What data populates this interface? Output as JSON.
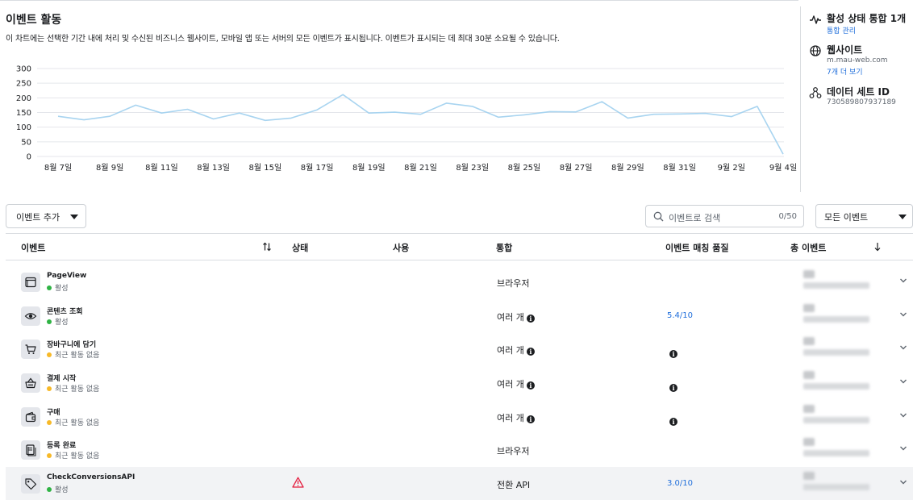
{
  "header": {
    "title": "이벤트 활동",
    "subtitle": "이 차트에는 선택한 기간 내에 처리 및 수신된 비즈니스 웹사이트, 모바일 앱 또는 서버의 모든 이벤트가 표시됩니다. 이벤트가 표시되는 데 최대 30분 소요될 수 있습니다."
  },
  "chart_data": {
    "type": "line",
    "y_ticks": [
      "300",
      "250",
      "200",
      "150",
      "100",
      "50",
      "0"
    ],
    "ylim": [
      0,
      300
    ],
    "x_tick_labels": [
      "8월 7일",
      "8월 9일",
      "8월 11일",
      "8월 13일",
      "8월 15일",
      "8월 17일",
      "8월 19일",
      "8월 21일",
      "8월 23일",
      "8월 25일",
      "8월 27일",
      "8월 29일",
      "8월 31일",
      "9월 2일",
      "9월 4일"
    ],
    "x": [
      "8월 7일",
      "8월 8일",
      "8월 9일",
      "8월 10일",
      "8월 11일",
      "8월 12일",
      "8월 13일",
      "8월 14일",
      "8월 15일",
      "8월 16일",
      "8월 17일",
      "8월 18일",
      "8월 19일",
      "8월 20일",
      "8월 21일",
      "8월 22일",
      "8월 23일",
      "8월 24일",
      "8월 25일",
      "8월 26일",
      "8월 27일",
      "8월 28일",
      "8월 29일",
      "8월 30일",
      "8월 31일",
      "9월 1일",
      "9월 2일",
      "9월 3일",
      "9월 4일"
    ],
    "values": [
      137,
      125,
      137,
      175,
      148,
      161,
      128,
      148,
      123,
      131,
      159,
      211,
      148,
      151,
      144,
      182,
      171,
      134,
      142,
      153,
      152,
      187,
      131,
      144,
      145,
      147,
      136,
      171,
      8
    ],
    "grid": true,
    "line_color": "#a8d4f0",
    "grid_color": "#e4e6eb"
  },
  "side_panel": {
    "integration_title": "활성 상태 통합 1개",
    "integration_link": "통합 관리",
    "website_title": "웹사이트",
    "website_domain": "m.mau-web.com",
    "website_more": "7개 더 보기",
    "dataset_title": "데이터 세트 ID",
    "dataset_id": "730589807937189"
  },
  "toolbar": {
    "add_event": "이벤트 추가",
    "search_placeholder": "이벤트로 검색",
    "search_count": "0/50",
    "filter": "모든 이벤트"
  },
  "table": {
    "columns": {
      "event": "이벤트",
      "status": "상태",
      "usage": "사용",
      "integration": "통합",
      "match_quality": "이벤트 매칭 품질",
      "total_events": "총 이벤트"
    },
    "rows": [
      {
        "name": "PageView",
        "status": "활성",
        "status_color": "#2fb344",
        "integration": "브라우저",
        "integration_info": false,
        "quality": "",
        "quality_info": false,
        "icon": "browser-window-icon",
        "warning": false
      },
      {
        "name": "콘텐츠 조회",
        "status": "활성",
        "status_color": "#2fb344",
        "integration": "여러 개",
        "integration_info": true,
        "quality": "5.4/10",
        "quality_info": false,
        "icon": "eye-icon",
        "warning": false
      },
      {
        "name": "장바구니에 담기",
        "status": "최근 활동 없음",
        "status_color": "#f7b928",
        "integration": "여러 개",
        "integration_info": true,
        "quality": "",
        "quality_info": true,
        "icon": "cart-icon",
        "warning": false
      },
      {
        "name": "결제 시작",
        "status": "최근 활동 없음",
        "status_color": "#f7b928",
        "integration": "여러 개",
        "integration_info": true,
        "quality": "",
        "quality_info": true,
        "icon": "basket-icon",
        "warning": false
      },
      {
        "name": "구매",
        "status": "최근 활동 없음",
        "status_color": "#f7b928",
        "integration": "여러 개",
        "integration_info": true,
        "quality": "",
        "quality_info": true,
        "icon": "wallet-icon",
        "warning": false
      },
      {
        "name": "등록 완료",
        "status": "최근 활동 없음",
        "status_color": "#f7b928",
        "integration": "브라우저",
        "integration_info": false,
        "quality": "",
        "quality_info": false,
        "icon": "document-icon",
        "warning": false
      },
      {
        "name": "CheckConversionsAPI",
        "status": "활성",
        "status_color": "#2fb344",
        "integration": "전환 API",
        "integration_info": false,
        "quality": "3.0/10",
        "quality_info": false,
        "icon": "tag-icon",
        "warning": true
      }
    ]
  }
}
